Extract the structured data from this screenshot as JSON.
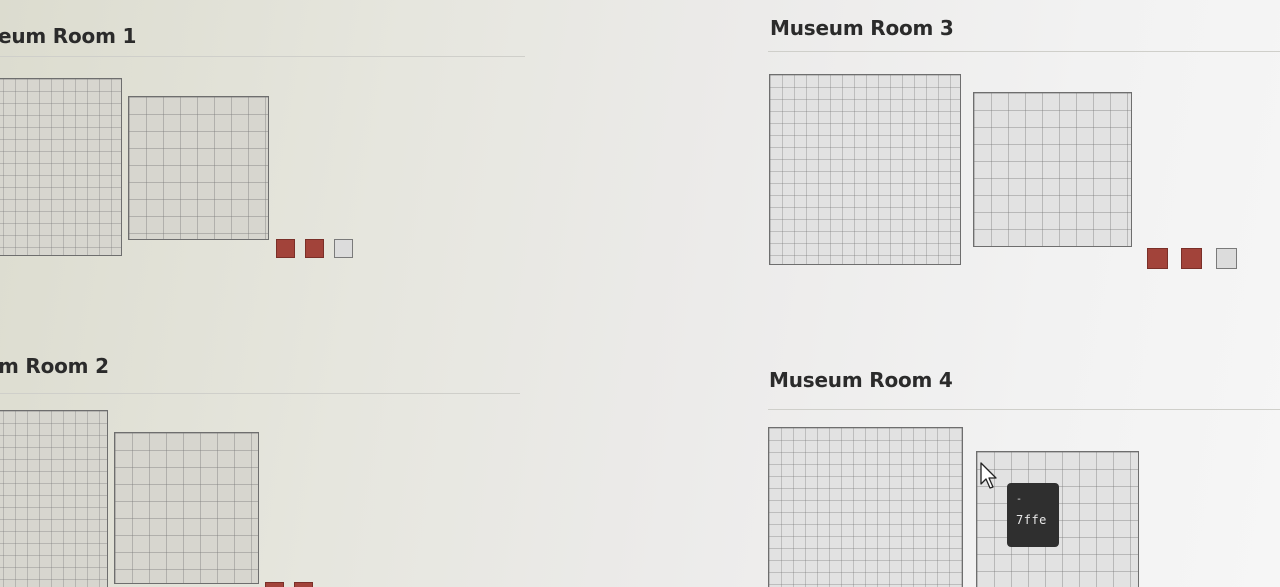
{
  "rooms": [
    {
      "title": "eum Room 1",
      "swatches": [
        "#a2433a",
        "#a2433a",
        "#dcdcdc"
      ]
    },
    {
      "title": "m Room 2",
      "swatches": [
        "#a2433a",
        "#a2433a"
      ]
    },
    {
      "title": "Museum Room 3",
      "swatches": [
        "#a2433a",
        "#a2433a",
        "#dcdcdc"
      ]
    },
    {
      "title": "Museum Room 4",
      "swatches": []
    }
  ],
  "tooltip": {
    "dash": "-",
    "code": "7ffe"
  },
  "colors": {
    "swatch_red": "#a2433a",
    "swatch_light": "#dcdcdc",
    "tooltip_bg": "#2f2f2f"
  },
  "icons": {
    "cursor": "arrow-pointer-icon"
  }
}
